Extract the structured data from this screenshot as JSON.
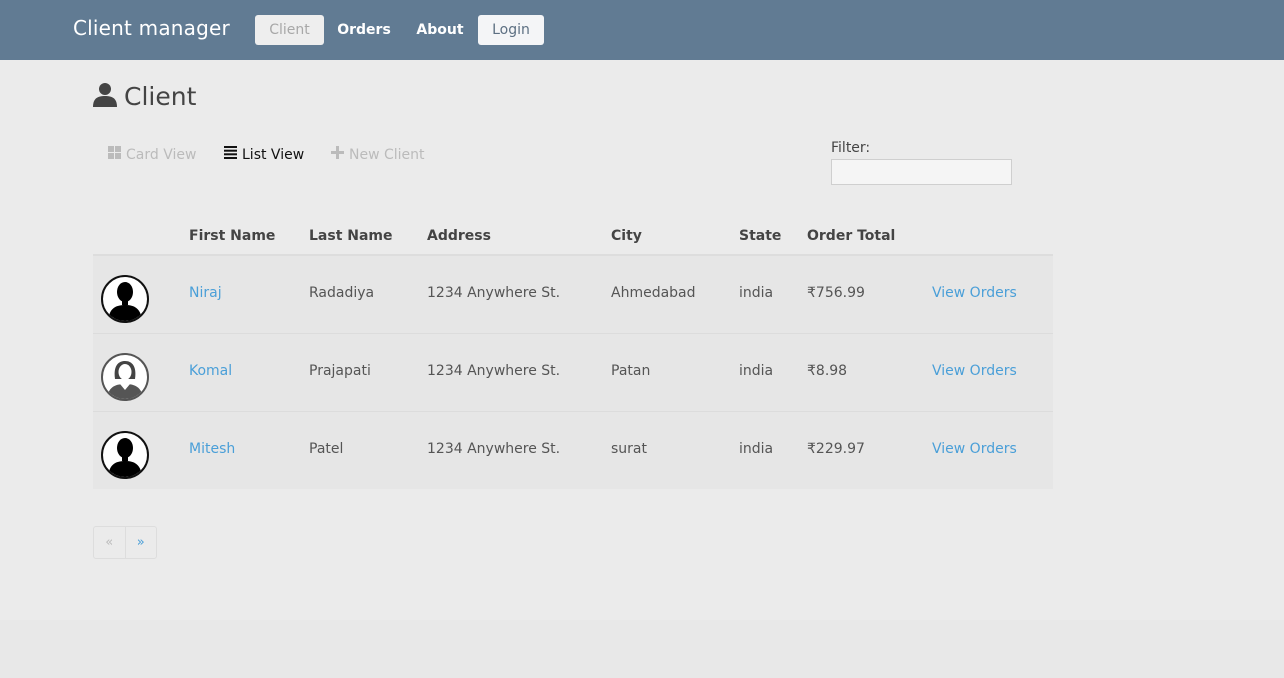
{
  "navbar": {
    "brand": "Client manager",
    "items": [
      {
        "label": "Client",
        "active": true
      },
      {
        "label": "Orders"
      },
      {
        "label": "About"
      },
      {
        "label": "Login"
      }
    ]
  },
  "page": {
    "title": "Client",
    "title_icon": "user-icon"
  },
  "toolbar": {
    "card_view": "Card View",
    "list_view": "List View",
    "new_client": "New Client"
  },
  "filter": {
    "label": "Filter:",
    "value": ""
  },
  "table": {
    "headers": [
      "",
      "First Name",
      "Last Name",
      "Address",
      "City",
      "State",
      "Order Total",
      ""
    ],
    "rows": [
      {
        "avatar": "male-avatar",
        "first": "Niraj",
        "last": "Radadiya",
        "address": "1234 Anywhere St.",
        "city": "Ahmedabad",
        "state": "india",
        "total": "₹756.99",
        "action": "View Orders"
      },
      {
        "avatar": "female-avatar",
        "first": "Komal",
        "last": "Prajapati",
        "address": "1234 Anywhere St.",
        "city": "Patan",
        "state": "india",
        "total": "₹8.98",
        "action": "View Orders"
      },
      {
        "avatar": "male-avatar",
        "first": "Mitesh",
        "last": "Patel",
        "address": "1234 Anywhere St.",
        "city": "surat",
        "state": "india",
        "total": "₹229.97",
        "action": "View Orders"
      }
    ]
  },
  "pagination": {
    "prev": "«",
    "next": "»"
  },
  "colors": {
    "navbar": "#617b93",
    "link": "#4a9fd8",
    "background": "#ebebeb"
  }
}
